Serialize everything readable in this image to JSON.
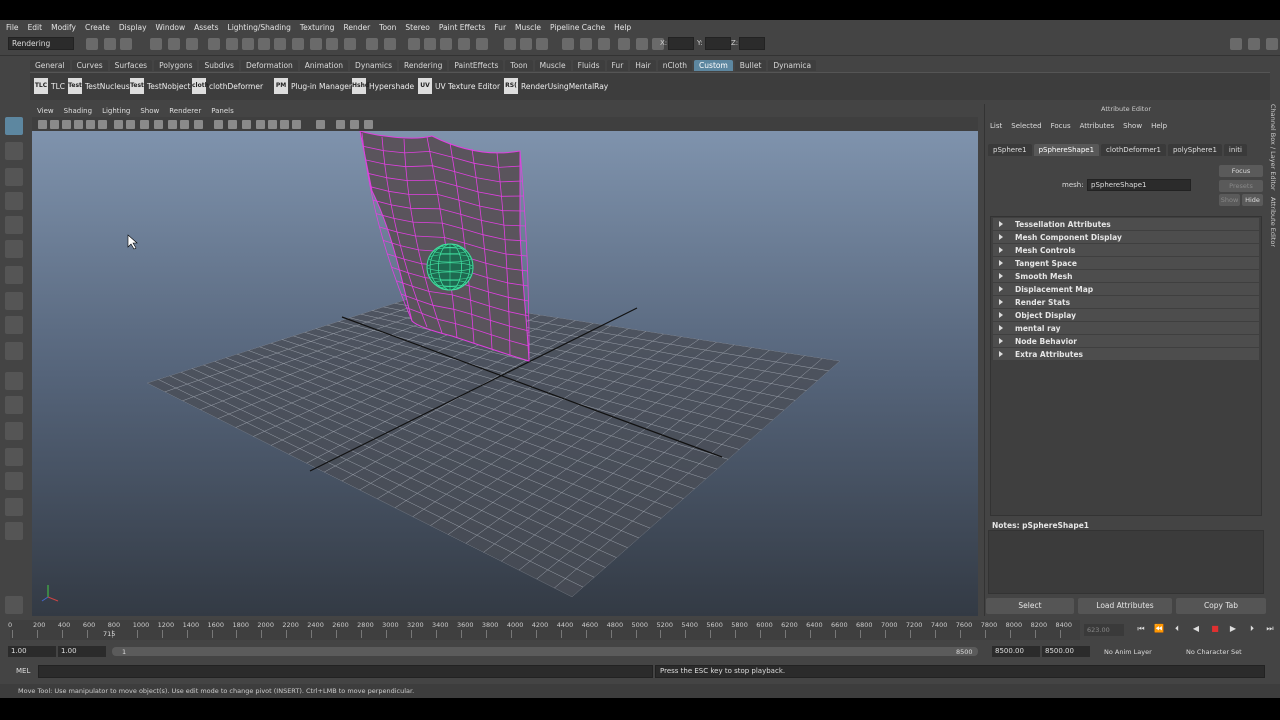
{
  "menubar": [
    "File",
    "Edit",
    "Modify",
    "Create",
    "Display",
    "Window",
    "Assets",
    "Lighting/Shading",
    "Texturing",
    "Render",
    "Toon",
    "Stereo",
    "Paint Effects",
    "Fur",
    "Muscle",
    "Pipeline Cache",
    "Help"
  ],
  "status": {
    "mode": "Rendering",
    "x_label": "X:",
    "y_label": "Y:",
    "z_label": "Z:"
  },
  "shelf_tabs": [
    "General",
    "Curves",
    "Surfaces",
    "Polygons",
    "Subdivs",
    "Deformation",
    "Animation",
    "Dynamics",
    "Rendering",
    "PaintEffects",
    "Toon",
    "Muscle",
    "Fluids",
    "Fur",
    "Hair",
    "nCloth",
    "Custom",
    "Bullet",
    "Dynamica"
  ],
  "shelf_tabs_active": "Custom",
  "shelf_items": [
    {
      "icon": "TLC",
      "label": "TLC"
    },
    {
      "icon": "Test",
      "label": "TestNucleus"
    },
    {
      "icon": "Test",
      "label": "TestNobject"
    },
    {
      "icon": "cloth",
      "label": "clothDeformer"
    },
    {
      "icon": "PM",
      "label": "Plug-in Manager"
    },
    {
      "icon": "Hshd",
      "label": "Hypershade"
    },
    {
      "icon": "UV",
      "label": "UV Texture Editor"
    },
    {
      "icon": "RS(",
      "label": "RenderUsingMentalRay"
    }
  ],
  "viewport": {
    "menu": [
      "View",
      "Shading",
      "Lighting",
      "Show",
      "Renderer",
      "Panels"
    ]
  },
  "attribute_editor": {
    "title": "Attribute Editor",
    "menu": [
      "List",
      "Selected",
      "Focus",
      "Attributes",
      "Show",
      "Help"
    ],
    "tabs": [
      "pSphere1",
      "pSphereShape1",
      "clothDeformer1",
      "polySphere1",
      "initi"
    ],
    "active_tab": "pSphereShape1",
    "mesh_label": "mesh:",
    "mesh_value": "pSphereShape1",
    "focus_btn": "Focus",
    "presets_btn": "Presets",
    "show_btn": "Show",
    "hide_btn": "Hide",
    "sections": [
      "Tessellation Attributes",
      "Mesh Component Display",
      "Mesh Controls",
      "Tangent Space",
      "Smooth Mesh",
      "Displacement Map",
      "Render Stats",
      "Object Display",
      "mental ray",
      "Node Behavior",
      "Extra Attributes"
    ],
    "notes_label": "Notes:  pSphereShape1",
    "buttons": [
      "Select",
      "Load Attributes",
      "Copy Tab"
    ]
  },
  "side_tabs": [
    "Channel Box / Layer Editor",
    "Attribute Editor"
  ],
  "timeline": {
    "ticks": [
      "0",
      "200",
      "400",
      "600",
      "800",
      "1000",
      "1200",
      "1400",
      "1600",
      "1800",
      "2000",
      "2200",
      "2400",
      "2600",
      "2800",
      "3000",
      "3200",
      "3400",
      "3600",
      "3800",
      "4000",
      "4200",
      "4400",
      "4600",
      "4800",
      "5000",
      "5200",
      "5400",
      "5600",
      "5800",
      "6000",
      "6200",
      "6400",
      "6600",
      "6800",
      "7000",
      "7200",
      "7400",
      "7600",
      "7800",
      "8000",
      "8200",
      "8400"
    ],
    "current_frame_marker": "715",
    "current_frame": "623.00"
  },
  "range": {
    "start": "1.00",
    "playback_start": "1.00",
    "slider_start": "1",
    "slider_end": "8500",
    "playback_end": "8500.00",
    "end": "8500.00",
    "anim_layer": "No Anim Layer",
    "char_set": "No Character Set"
  },
  "command": {
    "label": "MEL",
    "result": "Press the ESC key to stop playback."
  },
  "help_line": "Move Tool: Use manipulator to move object(s). Use edit mode to change pivot (INSERT). Ctrl+LMB to move perpendicular.",
  "colors": {
    "wire": "#e040e0",
    "sphere": "#40e0a0",
    "active_tab": "#5d87a0"
  }
}
